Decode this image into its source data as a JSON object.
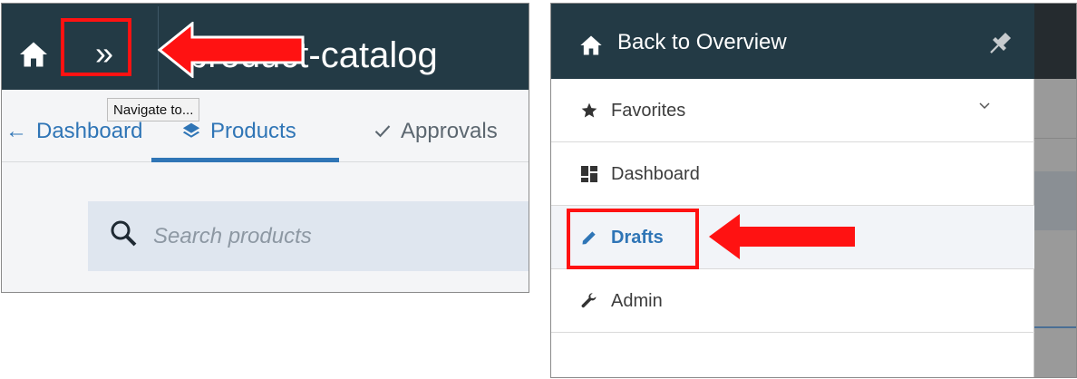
{
  "left": {
    "header": {
      "app_name": "product-catalog",
      "toggle_glyph": "»"
    },
    "tooltip": "Navigate to...",
    "tabs": [
      {
        "label": "Dashboard",
        "icon": "arrow-left-icon",
        "active": false
      },
      {
        "label": "Products",
        "icon": "layers-icon",
        "active": true
      },
      {
        "label": "Approvals",
        "icon": "checkmark-icon",
        "active": false
      }
    ],
    "search": {
      "placeholder": "Search products"
    }
  },
  "right": {
    "header": {
      "back_label": "Back to Overview"
    },
    "items": [
      {
        "label": "Favorites",
        "icon": "star-icon",
        "expandable": true
      },
      {
        "label": "Dashboard",
        "icon": "dashboard-icon"
      },
      {
        "label": "Drafts",
        "icon": "pencil-icon",
        "active": true
      },
      {
        "label": "Admin",
        "icon": "wrench-icon"
      }
    ]
  },
  "colors": {
    "header_bg": "#233a45",
    "accent_blue": "#2f75b6",
    "highlight_red": "#ff1212",
    "search_bg": "#dfe6ef"
  }
}
